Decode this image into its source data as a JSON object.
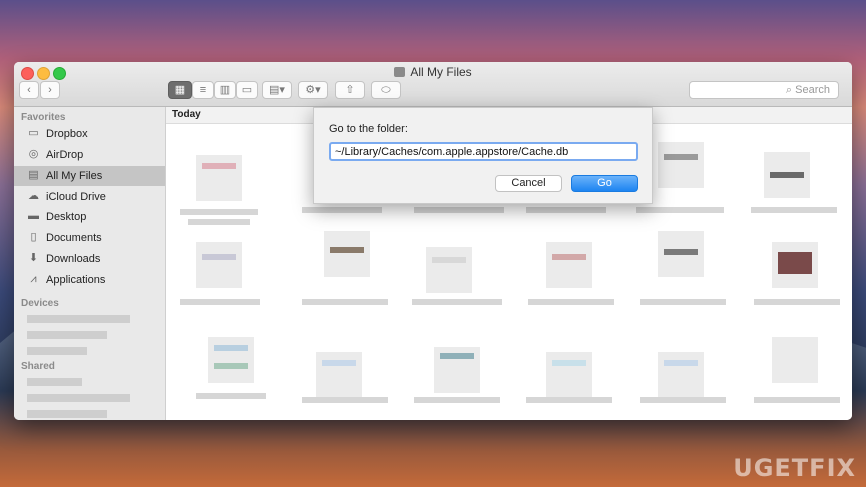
{
  "window": {
    "title": "All My Files"
  },
  "toolbar": {
    "search_placeholder": "Search"
  },
  "sidebar": {
    "favorites_heading": "Favorites",
    "items": [
      {
        "label": "Dropbox",
        "icon": "folder-icon"
      },
      {
        "label": "AirDrop",
        "icon": "airdrop-icon"
      },
      {
        "label": "All My Files",
        "icon": "all-files-icon",
        "selected": true
      },
      {
        "label": "iCloud Drive",
        "icon": "cloud-icon"
      },
      {
        "label": "Desktop",
        "icon": "desktop-icon"
      },
      {
        "label": "Documents",
        "icon": "documents-icon"
      },
      {
        "label": "Downloads",
        "icon": "downloads-icon"
      },
      {
        "label": "Applications",
        "icon": "applications-icon"
      }
    ],
    "devices_heading": "Devices",
    "shared_heading": "Shared"
  },
  "content": {
    "section_header": "Today"
  },
  "dialog": {
    "label": "Go to the folder:",
    "path_value": "~/Library/Caches/com.apple.appstore/Cache.db",
    "cancel_label": "Cancel",
    "go_label": "Go"
  },
  "watermark": "UGETFIX",
  "colors": {
    "accent": "#1d84f1",
    "selection": "#c5c5c5"
  }
}
